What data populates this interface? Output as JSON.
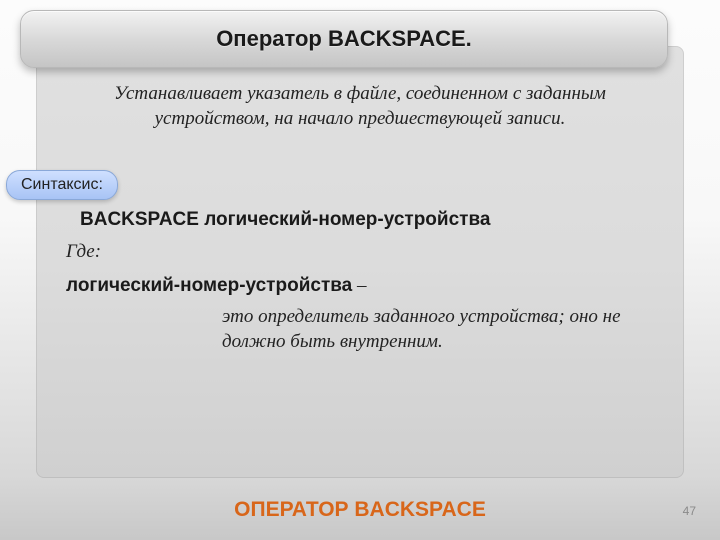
{
  "title": "Оператор BACKSPACE.",
  "description": "Устанавливает указатель в файле, соединенном с заданным устройством, на начало предшествующей записи.",
  "syntax_label": "Синтаксис:",
  "syntax_line": "BACKSPACE логический-номер-устройства",
  "where_label": "Где:",
  "param_name": "логический-номер-устройства",
  "param_dash": " –",
  "param_desc": "это определитель заданного устройства; оно не должно быть внутренним.",
  "footer": "ОПЕРАТОР BACKSPACE",
  "page_number": "47"
}
